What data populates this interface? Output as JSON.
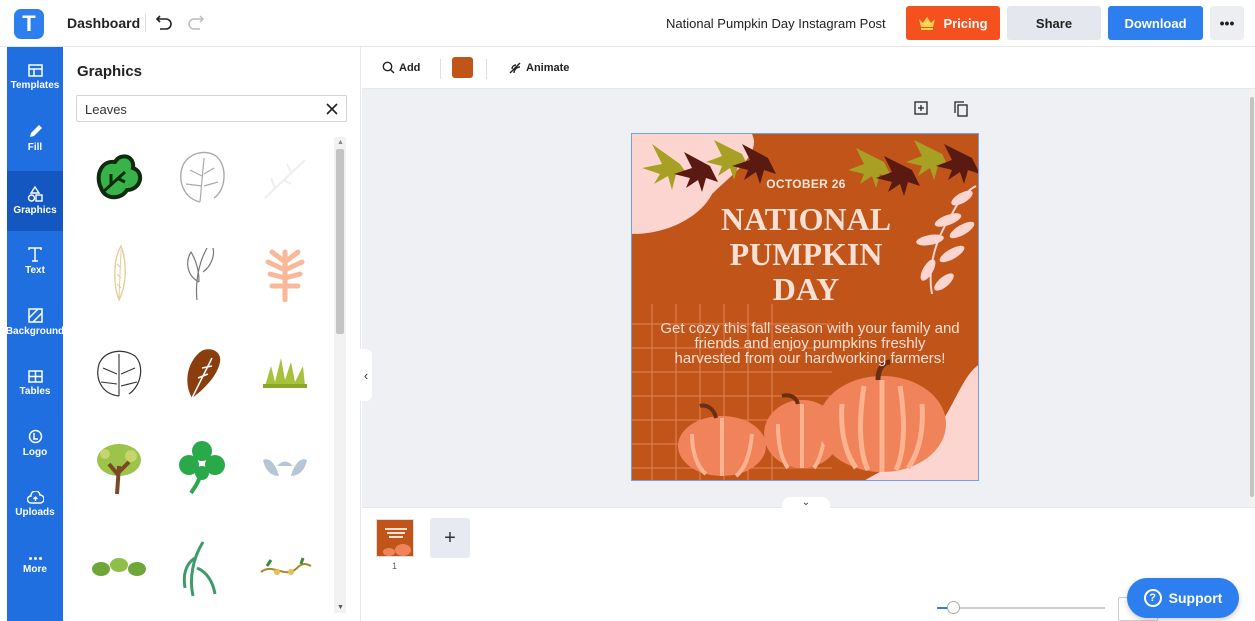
{
  "header": {
    "logo_letter": "T",
    "dashboard_label": "Dashboard",
    "document_title": "National Pumpkin Day Instagram Post",
    "pricing_label": "Pricing",
    "share_label": "Share",
    "download_label": "Download",
    "more_label": "•••"
  },
  "sidebar": {
    "items": [
      {
        "label": "Templates",
        "icon": "templates-icon"
      },
      {
        "label": "Fill",
        "icon": "fill-icon"
      },
      {
        "label": "Graphics",
        "icon": "graphics-icon",
        "active": true
      },
      {
        "label": "Text",
        "icon": "text-icon"
      },
      {
        "label": "Background",
        "icon": "background-icon"
      },
      {
        "label": "Tables",
        "icon": "tables-icon"
      },
      {
        "label": "Logo",
        "icon": "logo-icon"
      },
      {
        "label": "Uploads",
        "icon": "uploads-icon"
      },
      {
        "label": "More",
        "icon": "more-icon"
      }
    ]
  },
  "panel": {
    "title": "Graphics",
    "search_value": "Leaves"
  },
  "toolbar": {
    "add_label": "Add",
    "animate_label": "Animate",
    "fill_color": "#c05419"
  },
  "poster": {
    "date": "OCTOBER 26",
    "headline_line1": "NATIONAL",
    "headline_line2": "PUMPKIN",
    "headline_line3": "DAY",
    "body": "Get cozy this fall season with your family and friends and enjoy pumpkins freshly harvested from our hardworking farmers!"
  },
  "pages": {
    "page_number": "1",
    "add_label": "+"
  },
  "support_label": "Support",
  "colors": {
    "accent_blue": "#2d7ff0",
    "pricing_orange": "#f4511e",
    "poster_rust": "#c05419",
    "poster_pink": "#fdd5d0"
  }
}
